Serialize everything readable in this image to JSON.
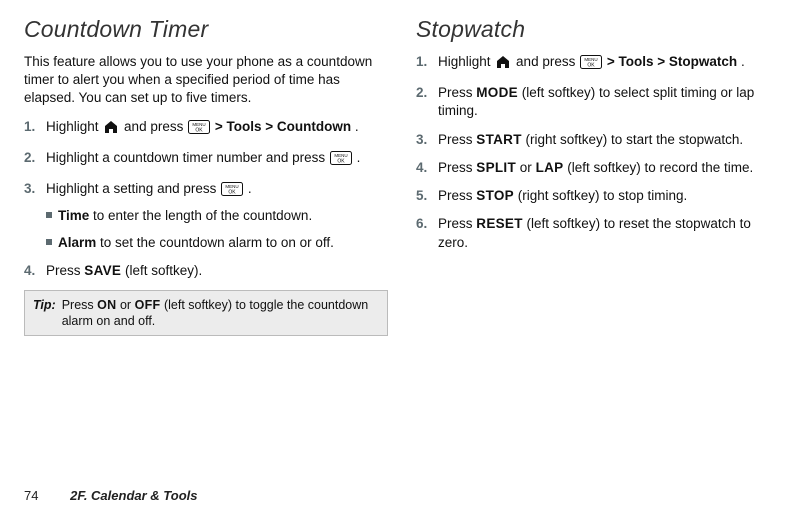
{
  "left": {
    "title": "Countdown Timer",
    "intro": "This feature allows you to use your phone as a countdown timer to alert you when a specified period of time has elapsed. You can set up to five timers.",
    "steps": {
      "s1_a": "Highlight ",
      "s1_b": " and press ",
      "s1_c": " > ",
      "s1_tools": "Tools",
      "s1_d": " > ",
      "s1_countdown": "Countdown",
      "s1_e": ".",
      "s2_a": "Highlight a countdown timer number and press ",
      "s2_b": ".",
      "s3_a": "Highlight a setting and press ",
      "s3_b": ".",
      "sub_time_label": "Time",
      "sub_time_text": " to enter the length of the countdown.",
      "sub_alarm_label": "Alarm",
      "sub_alarm_text": " to set the countdown alarm to on or off.",
      "s4_a": "Press ",
      "s4_save": "SAVE",
      "s4_b": " (left softkey)."
    },
    "tip": {
      "label": "Tip:",
      "a": "Press ",
      "on": "ON",
      "b": " or ",
      "off": "OFF",
      "c": " (left softkey) to toggle the countdown alarm on and off."
    }
  },
  "right": {
    "title": "Stopwatch",
    "steps": {
      "s1_a": "Highlight ",
      "s1_b": " and press ",
      "s1_c": " > ",
      "s1_tools": "Tools",
      "s1_d": " > ",
      "s1_stopwatch": "Stopwatch",
      "s1_e": ".",
      "s2_a": "Press ",
      "s2_mode": "MODE",
      "s2_b": " (left softkey) to select split timing or lap timing.",
      "s3_a": "Press ",
      "s3_start": "START",
      "s3_b": " (right softkey) to start the stopwatch.",
      "s4_a": "Press ",
      "s4_split": "SPLIT",
      "s4_b": " or ",
      "s4_lap": "LAP",
      "s4_c": " (left softkey) to record the time.",
      "s5_a": "Press ",
      "s5_stop": "STOP",
      "s5_b": " (right softkey) to stop timing.",
      "s6_a": "Press ",
      "s6_reset": "RESET",
      "s6_b": " (left softkey) to reset the stopwatch to zero."
    }
  },
  "footer": {
    "page": "74",
    "section": "2F. Calendar & Tools"
  }
}
